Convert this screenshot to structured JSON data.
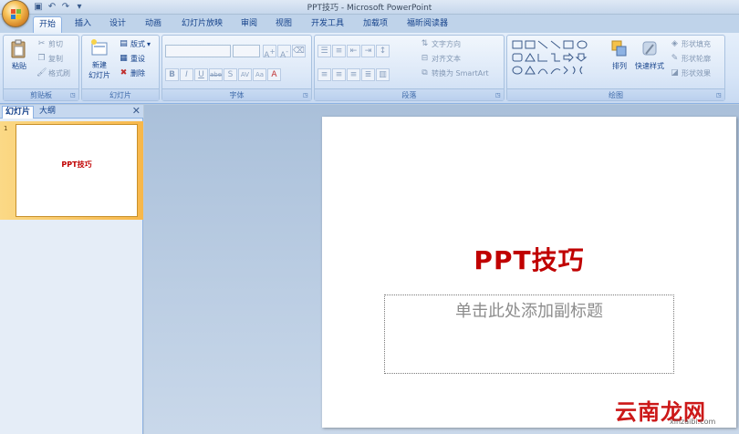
{
  "window": {
    "title": "PPT技巧 - Microsoft PowerPoint"
  },
  "tabs": [
    "开始",
    "插入",
    "设计",
    "动画",
    "幻灯片放映",
    "审阅",
    "视图",
    "开发工具",
    "加载项",
    "福昕阅读器"
  ],
  "ribbon": {
    "clipboard": {
      "label": "剪贴板",
      "paste": "粘贴",
      "cut": "剪切",
      "copy": "复制",
      "format_painter": "格式刷"
    },
    "slides": {
      "label": "幻灯片",
      "new_slide": "新建",
      "new_slide_line2": "幻灯片",
      "layout": "版式",
      "reset": "重设",
      "delete": "删除"
    },
    "font": {
      "label": "字体",
      "bold": "B",
      "italic": "I",
      "underline": "U",
      "strike": "abe",
      "shadow": "S",
      "spacing": "AV",
      "case": "Aa"
    },
    "paragraph": {
      "label": "段落",
      "text_direction": "文字方向",
      "align_text": "对齐文本",
      "convert_smartart": "转换为 SmartArt"
    },
    "drawing": {
      "label": "绘图",
      "arrange": "排列",
      "quick_styles": "快速样式",
      "shape_fill": "形状填充",
      "shape_outline": "形状轮廓",
      "shape_effects": "形状效果"
    }
  },
  "left_pane": {
    "tab_slides": "幻灯片",
    "tab_outline": "大纲",
    "slide_number": "1",
    "thumb_title": "PPT技巧"
  },
  "slide": {
    "title": "PPT技巧",
    "subtitle_placeholder": "单击此处添加副标题"
  },
  "watermark": {
    "brand": "云南龙网",
    "url": "xinzaibi.com"
  },
  "colors": {
    "title_red": "#c00000",
    "ribbon_text": "#15428b"
  }
}
